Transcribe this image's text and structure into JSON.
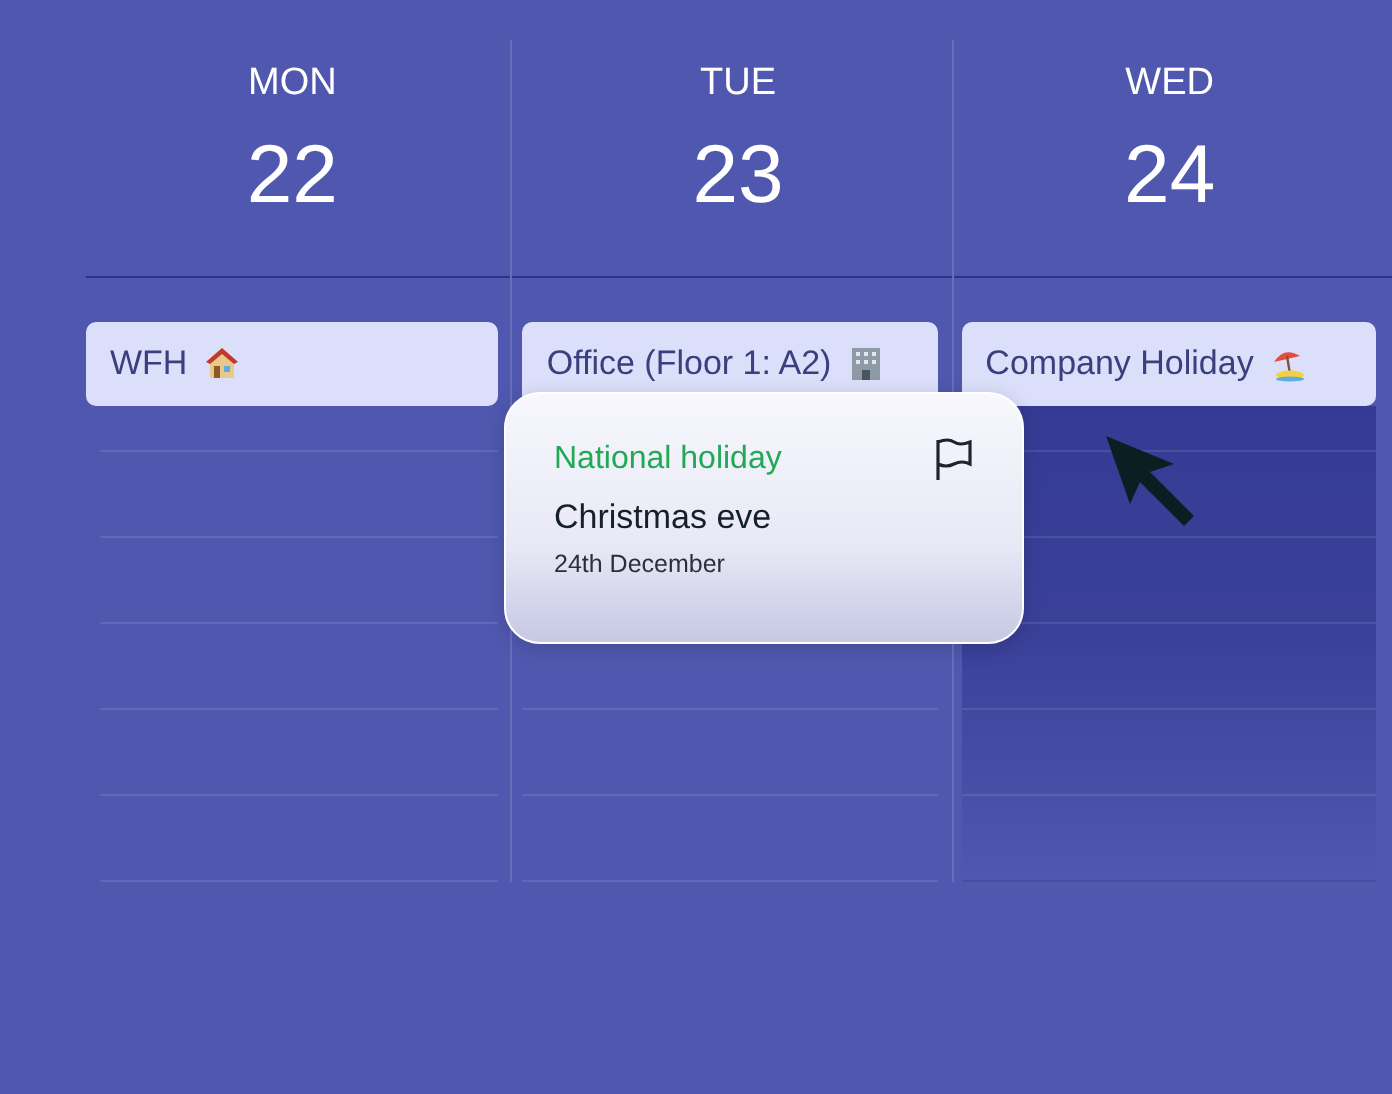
{
  "days": [
    {
      "name": "MON",
      "number": "22",
      "highlighted": false,
      "event": {
        "label": "WFH",
        "kind": "house"
      }
    },
    {
      "name": "TUE",
      "number": "23",
      "highlighted": false,
      "event": {
        "label": "Office (Floor 1: A2)",
        "kind": "building"
      }
    },
    {
      "name": "WED",
      "number": "24",
      "highlighted": true,
      "event": {
        "label": "Company Holiday",
        "kind": "umbrella"
      }
    }
  ],
  "popover": {
    "tag": "National holiday",
    "title": "Christmas eve",
    "date": "24th December"
  }
}
